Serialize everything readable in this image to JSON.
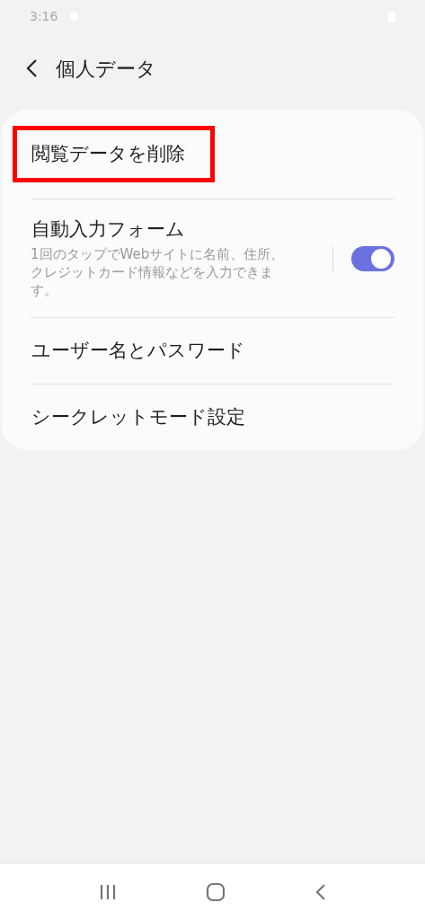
{
  "status_bar": {
    "time": "3:16"
  },
  "header": {
    "title": "個人データ"
  },
  "items": [
    {
      "kind": "link",
      "title": "閲覧データを削除",
      "highlighted": true
    },
    {
      "kind": "switch",
      "title": "自動入力フォーム",
      "description": "1回のタップでWebサイトに名前、住所、クレジットカード情報などを入力できます。",
      "on": true,
      "highlighted": false
    },
    {
      "kind": "link",
      "title": "ユーザー名とパスワード",
      "highlighted": false
    },
    {
      "kind": "link",
      "title": "シークレットモード設定",
      "highlighted": false
    }
  ]
}
